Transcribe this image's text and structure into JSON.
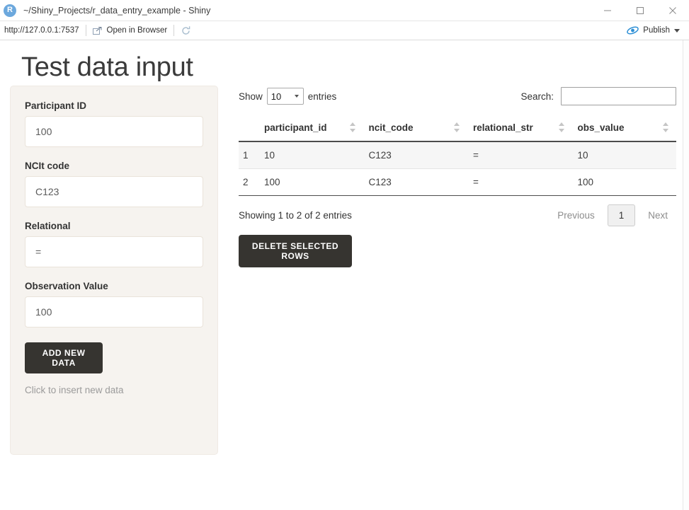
{
  "window": {
    "title": "~/Shiny_Projects/r_data_entry_example - Shiny",
    "app_icon_letter": "R",
    "minimize_icon": "minimize-icon",
    "maximize_icon": "maximize-icon",
    "close_icon": "close-icon"
  },
  "toolbar": {
    "url": "http://127.0.0.1:7537",
    "open_in_browser_label": "Open in Browser",
    "open_in_browser_icon": "external-window-icon",
    "refresh_icon": "refresh-icon",
    "publish_label": "Publish",
    "publish_icon": "publish-icon",
    "publish_caret_icon": "chevron-down-icon"
  },
  "page": {
    "title": "Test data input"
  },
  "sidebar": {
    "fields": [
      {
        "label": "Participant ID",
        "value": "100",
        "placeholder": ""
      },
      {
        "label": "NCIt code",
        "value": "C123",
        "placeholder": ""
      },
      {
        "label": "Relational",
        "value": "=",
        "placeholder": ""
      },
      {
        "label": "Observation Value",
        "value": "100",
        "placeholder": ""
      }
    ],
    "add_button_label": "ADD NEW DATA",
    "helper_text": "Click to insert new data",
    "panel_color": "#f6f3ef",
    "button_color": "#363430"
  },
  "table_controls": {
    "show_label": "Show",
    "entries_label": "entries",
    "page_length": "10",
    "search_label": "Search:",
    "search_value": "",
    "search_placeholder": ""
  },
  "table": {
    "columns": [
      "",
      "participant_id",
      "ncit_code",
      "relational_str",
      "obs_value"
    ],
    "rows": [
      {
        "index": "1",
        "participant_id": "10",
        "ncit_code": "C123",
        "relational_str": "=",
        "obs_value": "10"
      },
      {
        "index": "2",
        "participant_id": "100",
        "ncit_code": "C123",
        "relational_str": "=",
        "obs_value": "100"
      }
    ],
    "info": "Showing 1 to 2 of 2 entries",
    "pagination": {
      "previous_label": "Previous",
      "current_page": "1",
      "next_label": "Next"
    },
    "delete_button_label": "DELETE SELECTED ROWS"
  }
}
